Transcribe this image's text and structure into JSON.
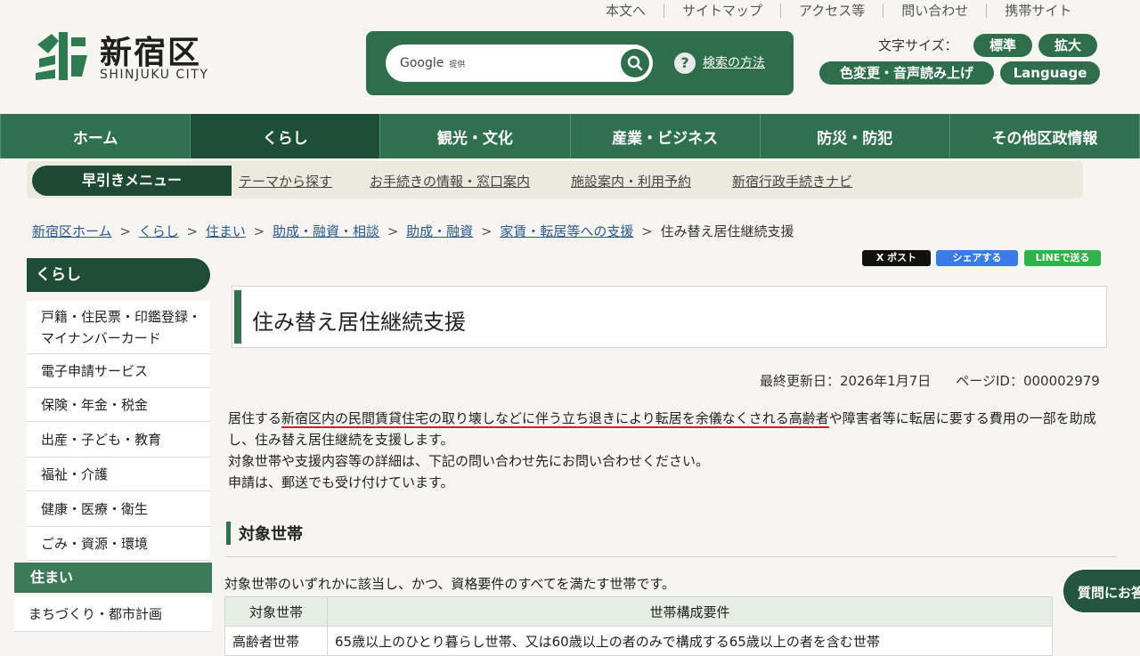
{
  "utility": [
    "本文へ",
    "サイトマップ",
    "アクセス等",
    "問い合わせ",
    "携帯サイト"
  ],
  "logo": {
    "jp": "新宿区",
    "en": "SHINJUKU CITY"
  },
  "search": {
    "google_label": "Google",
    "google_small": "提供",
    "help_link": "検索の方法",
    "help_icon": "?"
  },
  "fontsize": {
    "label": "文字サイズ：",
    "normal": "標準",
    "large": "拡大"
  },
  "tools": {
    "color_voice": "色変更・音声読み上げ",
    "language": "Language"
  },
  "nav": [
    "ホーム",
    "くらし",
    "観光・文化",
    "産業・ビジネス",
    "防災・防犯",
    "その他区政情報"
  ],
  "quick": {
    "title": "早引きメニュー",
    "links": [
      "テーマから探す",
      "お手続きの情報・窓口案内",
      "施設案内・利用予約",
      "新宿行政手続きナビ"
    ]
  },
  "breadcrumb": [
    "新宿区ホーム",
    "くらし",
    "住まい",
    "助成・融資・相談",
    "助成・融資",
    "家賃・転居等への支援"
  ],
  "breadcrumb_current": "住み替え居住継続支援",
  "breadcrumb_sep": ">",
  "sidebar": {
    "head": "くらし",
    "items": [
      "戸籍・住民票・印鑑登録・マイナンバーカード",
      "電子申請サービス",
      "保険・年金・税金",
      "出産・子ども・教育",
      "福祉・介護",
      "健康・医療・衛生",
      "ごみ・資源・環境"
    ],
    "sub": "住まい",
    "sub_items": [
      "まちづくり・都市計画"
    ]
  },
  "share": {
    "x": "X ポスト",
    "facebook": "シェアする",
    "line": "LINEで送る"
  },
  "page_title": "住み替え居住継続支援",
  "meta": {
    "updated": "最終更新日：2026年1月7日",
    "page_id": "ページID：000002979"
  },
  "body": {
    "line1_pre": "居住する",
    "line1_underlined": "新宿区内の民間賃貸住宅の取り壊しなどに伴う立ち退きにより転居を余儀なくされる高齢者",
    "line1_post": "や障害者等に転居に要する費用の一部を助成し、住み替え居住継続を支援します。",
    "line2": "対象世帯や支援内容等の詳細は、下記の問い合わせ先にお問い合わせください。",
    "line3": "申請は、郵送でも受け付けています。"
  },
  "section": {
    "title": "対象世帯",
    "desc": "対象世帯のいずれかに該当し、かつ、資格要件のすべてを満たす世帯です。"
  },
  "table": {
    "headers": [
      "対象世帯",
      "世帯構成要件"
    ],
    "row1": [
      "高齢者世帯",
      "65歳以上のひとり暮らし世帯、又は60歳以上の者のみで構成する65歳以上の者を含む世帯"
    ]
  },
  "question_button": "質問にお答え",
  "colors": {
    "green": "#2e7050",
    "dark_green": "#1e4a34",
    "red_underline": "#d21d28"
  }
}
